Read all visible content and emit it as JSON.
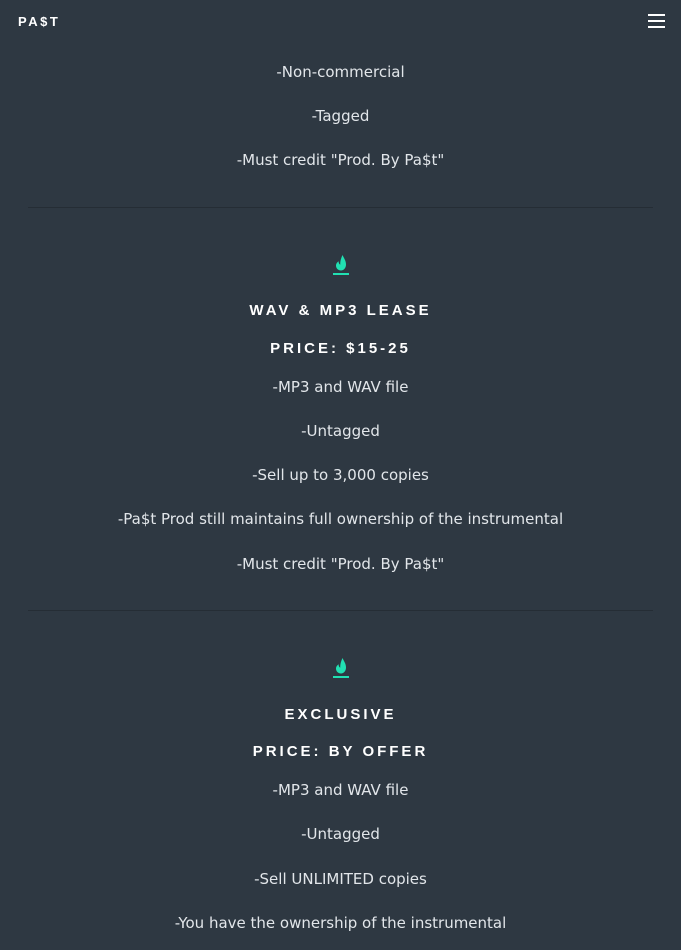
{
  "header": {
    "logo": "PA$T",
    "menu_icon": "hamburger-menu-icon"
  },
  "tiers": [
    {
      "features": [
        "-Non-commercial",
        "-Tagged",
        "-Must credit \"Prod. By Pa$t\""
      ]
    },
    {
      "icon": "flame-icon",
      "title": "WAV & MP3 LEASE",
      "price": "PRICE: $15-25",
      "features": [
        "-MP3 and WAV file",
        "-Untagged",
        "-Sell up to 3,000 copies",
        "-Pa$t Prod still maintains full ownership of the instrumental",
        "-Must credit \"Prod. By Pa$t\""
      ]
    },
    {
      "icon": "flame-icon",
      "title": "EXCLUSIVE",
      "price": "PRICE: BY OFFER",
      "features": [
        "-MP3 and WAV file",
        "-Untagged",
        "-Sell UNLIMITED copies",
        "-You have the ownership of the instrumental"
      ]
    }
  ],
  "colors": {
    "background": "#2e3842",
    "accent": "#21e0b2",
    "divider": "#252d35",
    "text": "#e4e8ec"
  }
}
